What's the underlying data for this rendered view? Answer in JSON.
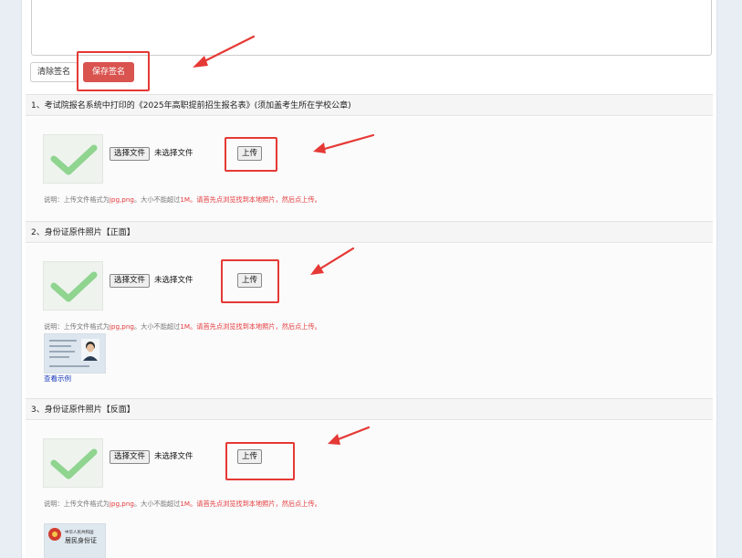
{
  "signature": {
    "clear_label": "清除签名",
    "save_label": "保存签名"
  },
  "sections": [
    {
      "title": "1、考试院报名系统中打印的《2025年高职提前招生报名表》(须加盖考生所在学校公章)",
      "choose_label": "选择文件",
      "file_status": "未选择文件",
      "upload_label": "上传"
    },
    {
      "title": "2、身份证原件照片【正面】",
      "choose_label": "选择文件",
      "file_status": "未选择文件",
      "upload_label": "上传",
      "sample_link": "查看示例"
    },
    {
      "title": "3、身份证原件照片【反面】",
      "choose_label": "选择文件",
      "file_status": "未选择文件",
      "upload_label": "上传"
    }
  ],
  "note": {
    "prefix": "说明：上传文件格式为",
    "formats": "jpg,png",
    "middle": "。大小不能超过",
    "size": "1M",
    "suffix": "。请首先点浏览找到本地照片，然后点上传。"
  },
  "id_back_sample_text": {
    "line1": "中华人民共和国",
    "line2": "居民身份证"
  },
  "colors": {
    "accent_red": "#d9534f",
    "annotation_red": "#e53935",
    "link_blue": "#1a3bbd",
    "check_green": "#8fd48f"
  }
}
